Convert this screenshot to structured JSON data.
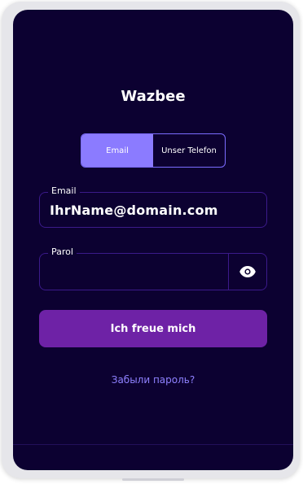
{
  "app": {
    "title": "Wazbee"
  },
  "login_mode_tabs": [
    {
      "label": "Email",
      "selected": true
    },
    {
      "label": "Unser Telefon",
      "selected": false
    }
  ],
  "email_field": {
    "label": "Email",
    "value": "IhrName@domain.com"
  },
  "password_field": {
    "label": "Parol",
    "value": "",
    "toggle_icon": "eye-icon"
  },
  "primary_button": {
    "label": "Ich freue mich"
  },
  "forgot_password": {
    "label": "Забыли пароль?"
  },
  "colors": {
    "background": "#0c0131",
    "accent": "#8b7bff",
    "button": "#6e22a6",
    "field_border": "#3b1a8a",
    "link": "#8f81ff"
  }
}
